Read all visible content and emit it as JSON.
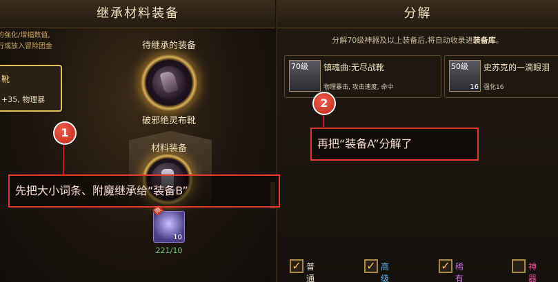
{
  "left": {
    "title": "继承材料装备",
    "hint_lines": [
      "的强化/增幅数值,",
      "行或放入冒险团金"
    ],
    "item_card": {
      "name": "靴",
      "stats": "+35, 物理暴"
    },
    "target_slot_title": "待继承的装备",
    "target_item_name": "破邪绝灵布靴",
    "material_slot_title": "材料装备",
    "material_count": "221/10",
    "crystal_count": "10",
    "crystal_tag": "限"
  },
  "right": {
    "title": "分解",
    "info_prefix": "分解70级神器及以上装备后,将自动收录进",
    "info_bold": "装备库",
    "info_suffix": "。",
    "equipment": [
      {
        "level": "70级",
        "name": "镇魂曲:无尽战靴",
        "stats": "物理暴击, 攻击速度, 命中",
        "plus": ""
      },
      {
        "level": "50级",
        "name": "史苏克的一滴眼泪",
        "stats": "强化16",
        "plus": "16"
      }
    ],
    "filters": [
      {
        "label": "普通",
        "checked": true,
        "color": "#e8e0cc"
      },
      {
        "label": "高级",
        "checked": true,
        "color": "#5fb4f0"
      },
      {
        "label": "稀有",
        "checked": true,
        "color": "#c86ce0"
      },
      {
        "label": "神器",
        "checked": false,
        "color": "#e84fa0"
      }
    ]
  },
  "annotations": [
    {
      "number": "1",
      "text": "先把大小词条、附魔继承给“装备B”"
    },
    {
      "number": "2",
      "text": "再把“装备A”分解了"
    }
  ],
  "check_mark": "✓"
}
